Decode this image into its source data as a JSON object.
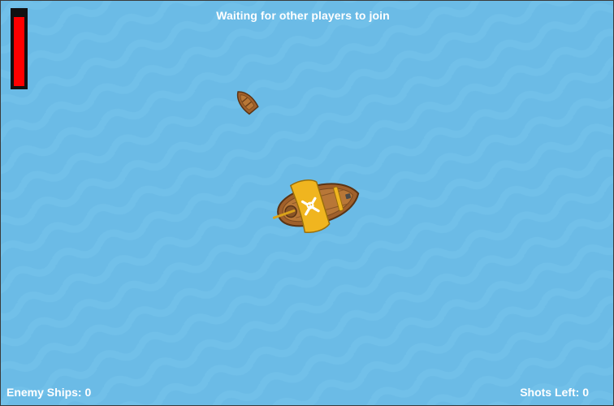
{
  "game": {
    "status_message": "Waiting for other players to join",
    "health": {
      "level": 0.92
    },
    "hud": {
      "enemy_ships_label": "Enemy Ships:",
      "enemy_ships_value": "0",
      "shots_left_label": "Shots Left:",
      "shots_left_value": "0"
    },
    "sprites": [
      {
        "name": "player-pirate-ship",
        "icon": "skull-crossbones-sail"
      },
      {
        "name": "enemy-rowboat",
        "icon": "small-wooden-boat"
      }
    ]
  },
  "colors": {
    "ocean": "#6bbbe6",
    "wave_highlight": "#74c1ea",
    "health": "#ff0000",
    "hull": "#a0602b",
    "sail": "#f0b51f",
    "hud_text": "#ffffff"
  }
}
